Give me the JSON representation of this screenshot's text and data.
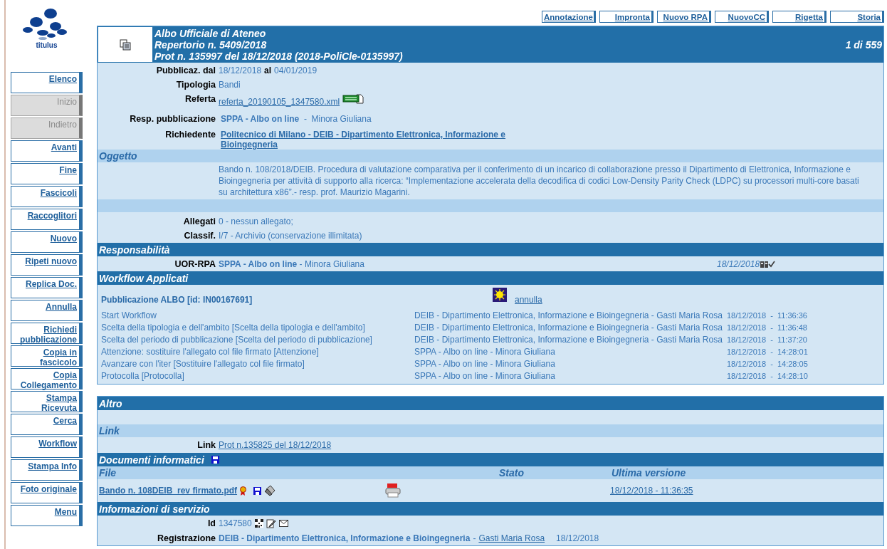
{
  "logo": {
    "text": "titulus"
  },
  "sidebar": [
    {
      "label": "Elenco",
      "disabled": false
    },
    {
      "label": "Inizio",
      "disabled": true
    },
    {
      "label": "Indietro",
      "disabled": true
    },
    {
      "label": "Avanti",
      "disabled": false
    },
    {
      "label": "Fine",
      "disabled": false
    },
    {
      "label": "Fascicoli",
      "disabled": false
    },
    {
      "label": "Raccoglitori",
      "disabled": false
    },
    {
      "label": "Nuovo",
      "disabled": false
    },
    {
      "label": "Ripeti nuovo",
      "disabled": false
    },
    {
      "label": "Replica Doc.",
      "disabled": false
    },
    {
      "label": "Annulla",
      "disabled": false
    },
    {
      "label": "Richiedi pubblicazione",
      "disabled": false
    },
    {
      "label": "Copia in fascicolo",
      "disabled": false
    },
    {
      "label": "Copia Collegamento",
      "disabled": false
    },
    {
      "label": "Stampa Ricevuta",
      "disabled": false
    },
    {
      "label": "Cerca",
      "disabled": false
    },
    {
      "label": "Workflow",
      "disabled": false
    },
    {
      "label": "Stampa Info",
      "disabled": false
    },
    {
      "label": "Foto originale",
      "disabled": false
    },
    {
      "label": "Menu",
      "disabled": false
    }
  ],
  "actions": [
    "Annotazione",
    "Impronta",
    "Nuovo RPA",
    "NuovoCC",
    "Rigetta",
    "Storia"
  ],
  "header": {
    "lines": [
      "Albo Ufficiale di Ateneo",
      "Repertorio n. 5409/2018",
      "Prot n. 135997 del 18/12/2018  (2018-PoliCle-0135997)"
    ],
    "counter": "1 di 559"
  },
  "fields": [
    {
      "kind": "period",
      "label": "Pubblicaz. dal",
      "from": "18/12/2018",
      "joiner": "al",
      "to": "04/01/2019"
    },
    {
      "kind": "text",
      "label": "Tipologia",
      "value": "Bandi"
    },
    {
      "kind": "file",
      "label": "Referta",
      "value": "referta_20190105_1347580.xml"
    },
    {
      "kind": "rich",
      "label": "Resp. pubblicazione",
      "value": "**SPPA - Albo on line**  -  Minora Giuliana"
    },
    {
      "kind": "link",
      "label": "Richiedente",
      "value": "Politecnico di Milano - DEIB - Dipartimento Elettronica, Informazione e Bioingegneria"
    }
  ],
  "oggetto": {
    "title": "Oggetto",
    "text": "Bando n. 108/2018/DEIB. Procedura di valutazione comparativa per il conferimento di un incarico di collaborazione presso il Dipartimento di Elettronica, Informazione e Bioingegneria per attività di supporto alla ricerca: “Implementazione accelerata della decodifica di codici Low-Density Parity Check (LDPC) su processori multi-core basati su architettura x86”.- resp. prof. Maurizio Magarini."
  },
  "details": [
    {
      "kind": "text",
      "label": "Allegati",
      "value": "0 - nessun allegato;"
    },
    {
      "kind": "text",
      "label": "Classif.",
      "value": "I/7 - Archivio (conservazione illimitata)"
    }
  ],
  "responsabilita": {
    "title": "Responsabilità",
    "label": "UOR-RPA",
    "value": "**SPPA - Albo on line** - Minora Giuliana",
    "date": "18/12/2018"
  },
  "workflow": {
    "title": "Workflow Applicati",
    "name": "Pubblicazione ALBO [id: IN00167691]",
    "action": "annulla",
    "steps": [
      {
        "step": "Start Workflow",
        "actor": "DEIB - Dipartimento Elettronica, Informazione e Bioingegneria - Gasti Maria Rosa",
        "time": "18/12/2018  -  11:36:36"
      },
      {
        "step": "Scelta della tipologia e dell'ambito [Scelta della tipologia e dell'ambito]",
        "actor": "DEIB - Dipartimento Elettronica, Informazione e Bioingegneria - Gasti Maria Rosa",
        "time": "18/12/2018  -  11:36:48"
      },
      {
        "step": "Scelta del periodo di pubblicazione [Scelta del periodo di pubblicazione]",
        "actor": "DEIB - Dipartimento Elettronica, Informazione e Bioingegneria - Gasti Maria Rosa",
        "time": "18/12/2018  -  11:37:20"
      },
      {
        "step": "Attenzione: sostituire l'allegato col file firmato [Attenzione]",
        "actor": "SPPA - Albo on line - Minora Giuliana",
        "time": "18/12/2018  -  14:28:01"
      },
      {
        "step": "Avanzare con l'iter [Sostituire l'allegato col file firmato]",
        "actor": "SPPA - Albo on line - Minora Giuliana",
        "time": "18/12/2018  -  14:28:05"
      },
      {
        "step": "Protocolla [Protocolla]",
        "actor": "SPPA - Albo on line - Minora Giuliana",
        "time": "18/12/2018  -  14:28:10"
      }
    ]
  },
  "altro": {
    "title": "Altro"
  },
  "link": {
    "title": "Link",
    "label": "Link",
    "value": "Prot n.135825 del 18/12/2018"
  },
  "documenti": {
    "title": "Documenti informatici",
    "columns": [
      "File",
      "Stato",
      "Ultima versione"
    ],
    "files": [
      {
        "name": "Bando n. 108DEIB_rev firmato.pdf",
        "version": "18/12/2018 - 11:36:35"
      }
    ]
  },
  "servizio": {
    "title": "Informazioni di servizio",
    "id_label": "Id",
    "id": "1347580",
    "reg_label": "Registrazione",
    "office": "DEIB - Dipartimento Elettronica, Informazione e Bioingegneria",
    "separator": "-",
    "person": "Gasti Maria Rosa",
    "date": "18/12/2018"
  }
}
